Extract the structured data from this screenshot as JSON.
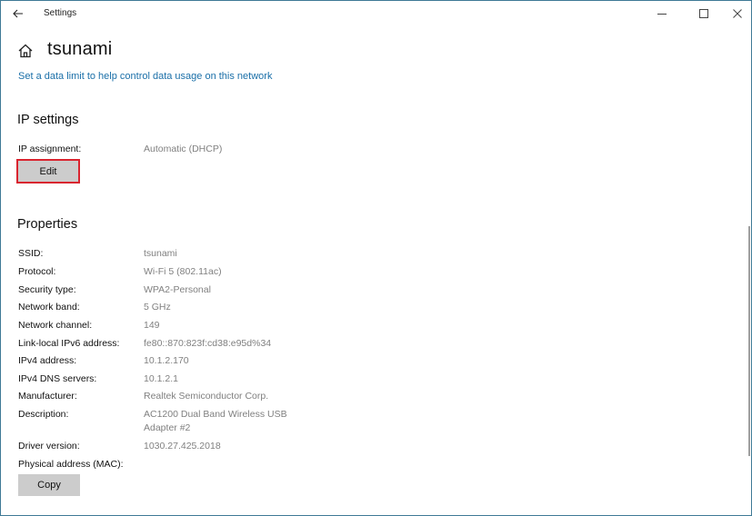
{
  "window": {
    "app_title": "Settings",
    "controls": {
      "minimize": "minimize-icon",
      "maximize": "maximize-icon",
      "close": "close-icon"
    }
  },
  "header": {
    "back_icon": "arrow-left-icon",
    "home_icon": "home-icon",
    "title": "tsunami",
    "data_limit_link": "Set a data limit to help control data usage on this network"
  },
  "ip_settings": {
    "title": "IP settings",
    "assignment_label": "IP assignment:",
    "assignment_value": "Automatic (DHCP)",
    "edit_button": "Edit",
    "highlight_color": "#d9242f"
  },
  "properties": {
    "title": "Properties",
    "rows": [
      {
        "label": "SSID:",
        "value": "tsunami"
      },
      {
        "label": "Protocol:",
        "value": "Wi-Fi 5 (802.11ac)"
      },
      {
        "label": "Security type:",
        "value": "WPA2-Personal"
      },
      {
        "label": "Network band:",
        "value": "5 GHz"
      },
      {
        "label": "Network channel:",
        "value": "149"
      },
      {
        "label": "Link-local IPv6 address:",
        "value": "fe80::870:823f:cd38:e95d%34"
      },
      {
        "label": "IPv4 address:",
        "value": "10.1.2.170"
      },
      {
        "label": "IPv4 DNS servers:",
        "value": "10.1.2.1"
      },
      {
        "label": "Manufacturer:",
        "value": "Realtek Semiconductor Corp."
      },
      {
        "label": "Description:",
        "value": "AC1200  Dual Band Wireless USB Adapter #2"
      },
      {
        "label": "Driver version:",
        "value": "1030.27.425.2018"
      },
      {
        "label": "Physical address (MAC):",
        "value": ""
      }
    ],
    "copy_button": "Copy"
  }
}
